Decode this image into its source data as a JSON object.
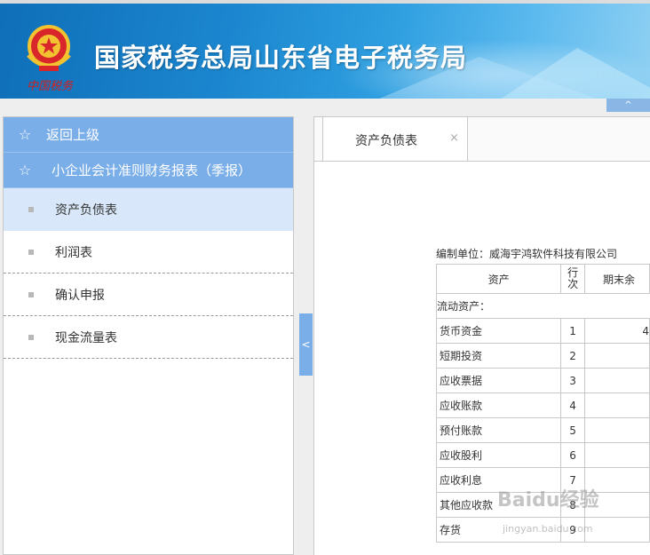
{
  "header": {
    "title": "国家税务总局山东省电子税务局",
    "emblem_signature": "中国税务",
    "collapse_symbol": "^"
  },
  "sidebar": {
    "back_label": "返回上级",
    "section_label": "小企业会计准则财务报表（季报）",
    "items": [
      {
        "label": "资产负债表",
        "active": true
      },
      {
        "label": "利润表"
      },
      {
        "label": "确认申报"
      },
      {
        "label": "现金流量表"
      }
    ],
    "toggle_symbol": "<"
  },
  "tabs": [
    {
      "label": "资产负债表",
      "close": "×"
    }
  ],
  "report": {
    "company_line": "编制单位：威海宇鸿软件科技有限公司",
    "columns": [
      "资产",
      "行次",
      "期末余"
    ],
    "section": "流动资产：",
    "rows": [
      {
        "name": "货币资金",
        "line": "1",
        "value": "4"
      },
      {
        "name": "短期投资",
        "line": "2",
        "value": ""
      },
      {
        "name": "应收票据",
        "line": "3",
        "value": ""
      },
      {
        "name": "应收账款",
        "line": "4",
        "value": ""
      },
      {
        "name": "预付账款",
        "line": "5",
        "value": ""
      },
      {
        "name": "应收股利",
        "line": "6",
        "value": ""
      },
      {
        "name": "应收利息",
        "line": "7",
        "value": ""
      },
      {
        "name": "其他应收款",
        "line": "8",
        "value": ""
      },
      {
        "name": "存货",
        "line": "9",
        "value": ""
      }
    ]
  },
  "watermark": {
    "logo": "Baidu经验",
    "url": "jingyan.baidu.com"
  },
  "colors": {
    "sidebar_header": "#7aaee8",
    "sidebar_active": "#d8e8fa",
    "banner": "#1b86cf"
  }
}
